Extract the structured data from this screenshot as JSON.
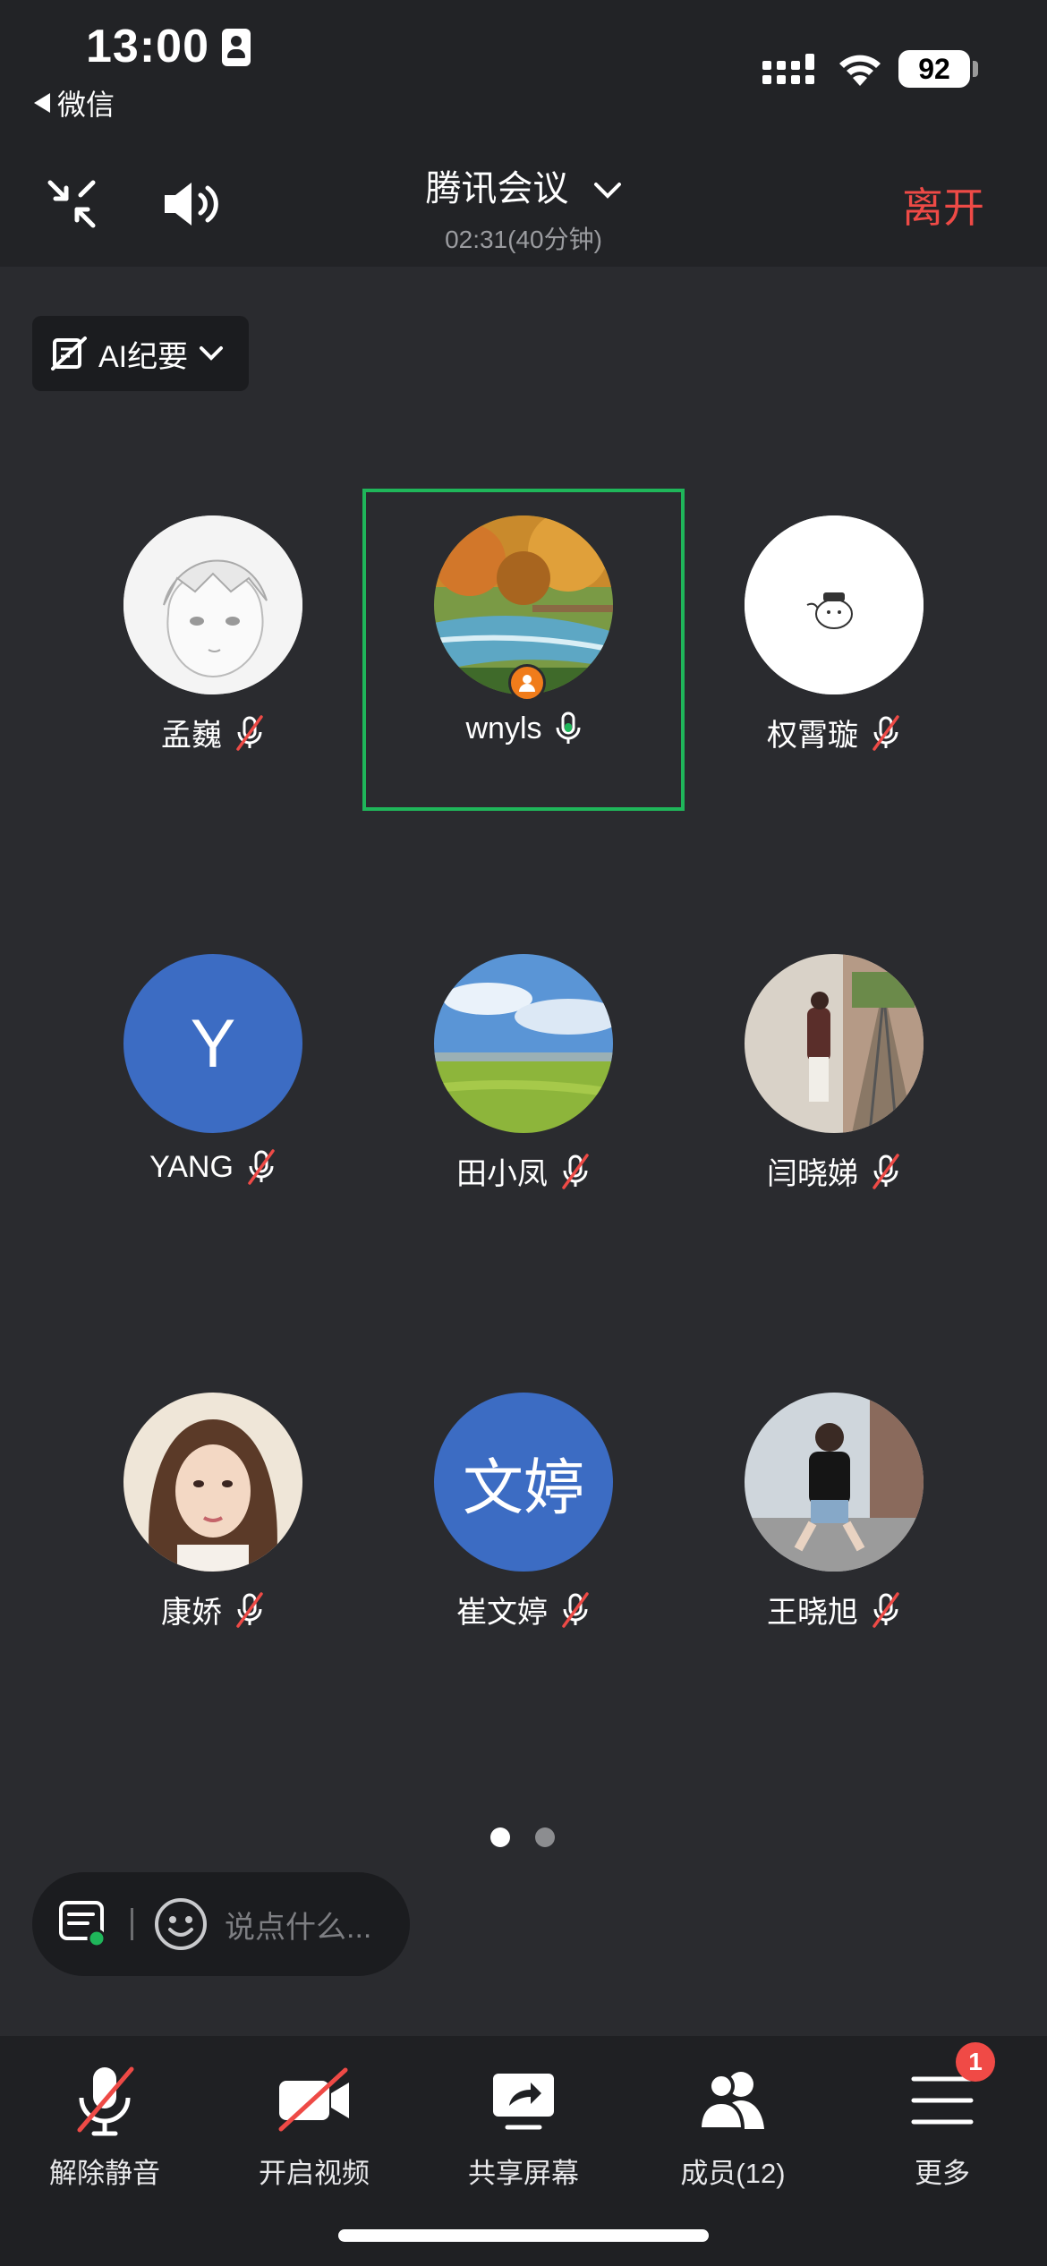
{
  "status": {
    "time": "13:00",
    "back_app": "微信",
    "battery": "92"
  },
  "header": {
    "title": "腾讯会议",
    "duration": "02:31(40分钟)",
    "leave": "离开"
  },
  "ai": {
    "label": "AI纪要"
  },
  "participants": [
    {
      "name": "孟巍",
      "mic": "muted",
      "avatar": "sketch"
    },
    {
      "name": "wnyls",
      "mic": "speaking",
      "avatar": "forest",
      "host": true,
      "active": true
    },
    {
      "name": "权霄璇",
      "mic": "muted",
      "avatar": "cartoon"
    },
    {
      "name": "YANG",
      "mic": "muted",
      "avatar_text": "Y"
    },
    {
      "name": "田小凤",
      "mic": "muted",
      "avatar": "field"
    },
    {
      "name": "闫晓娣",
      "mic": "muted",
      "avatar": "rail"
    },
    {
      "name": "康娇",
      "mic": "muted",
      "avatar": "portrait"
    },
    {
      "name": "崔文婷",
      "mic": "muted",
      "avatar_text": "文婷"
    },
    {
      "name": "王晓旭",
      "mic": "muted",
      "avatar": "street"
    }
  ],
  "pager": {
    "pages": 2,
    "current": 1
  },
  "chat": {
    "placeholder": "说点什么..."
  },
  "bottombar": {
    "unmute": "解除静音",
    "video": "开启视频",
    "share": "共享屏幕",
    "members": "成员(12)",
    "more": "更多",
    "more_badge": "1"
  },
  "colors": {
    "background": "#2a2b2f",
    "leave": "#ee4a46",
    "active_border": "#1fb65a",
    "letter_avatar": "#3c6cc3",
    "host_badge": "#f07c1b"
  }
}
